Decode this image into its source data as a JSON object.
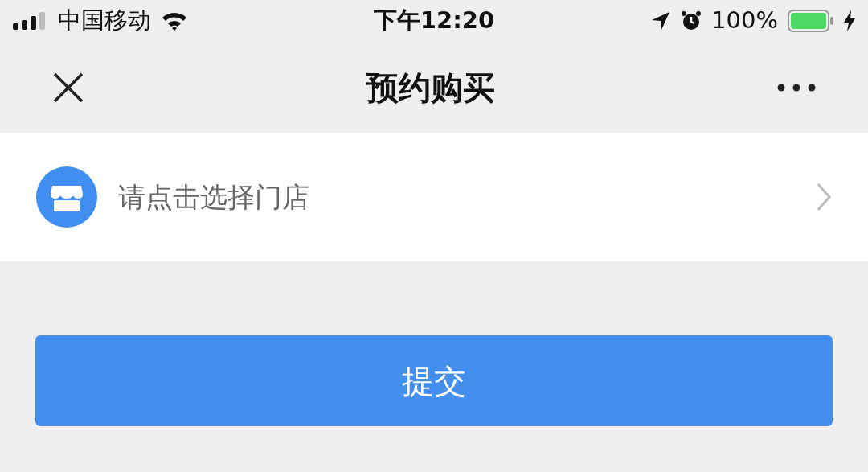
{
  "status_bar": {
    "carrier": "中国移动",
    "time": "下午12:20",
    "battery": "100%"
  },
  "nav_bar": {
    "title": "预约购买"
  },
  "store_row": {
    "label": "请点击选择门店"
  },
  "submit_button": {
    "label": "提交"
  }
}
